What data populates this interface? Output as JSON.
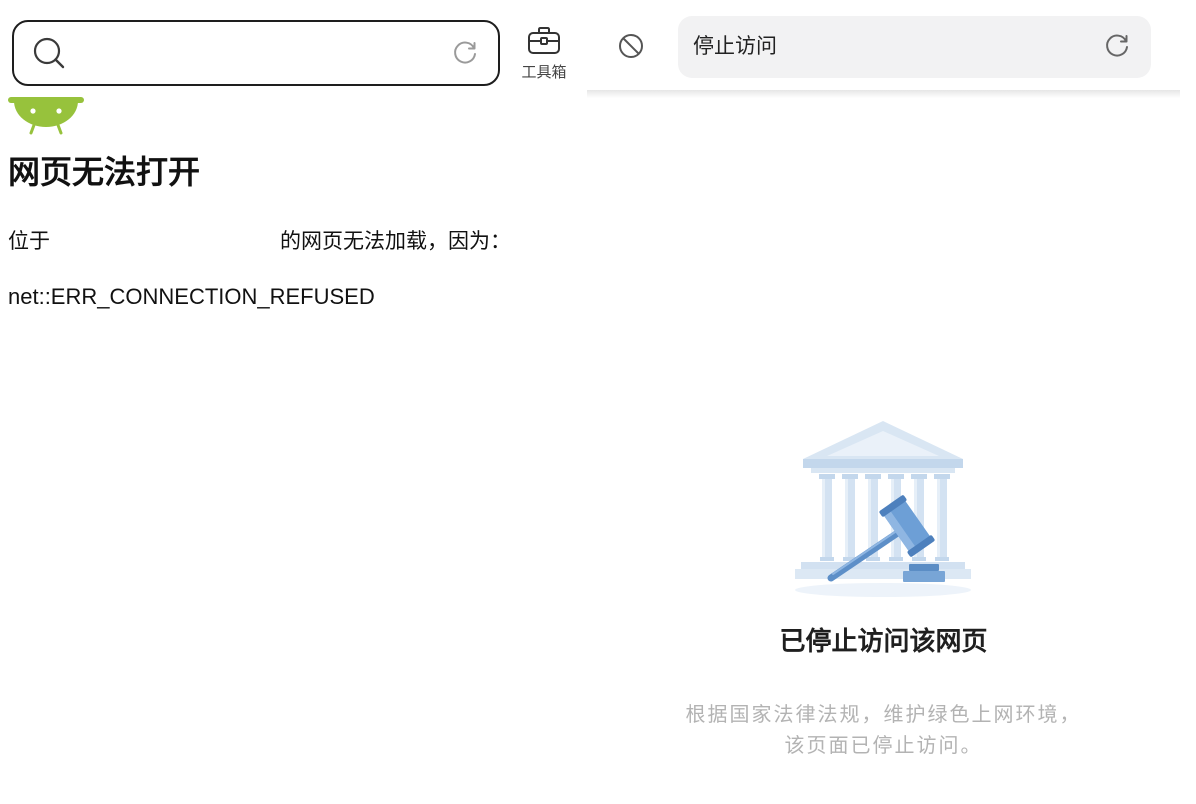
{
  "left": {
    "search_bar": {
      "icons": {
        "search": "search-icon",
        "reload": "reload-icon"
      }
    },
    "toolbox": {
      "label": "工具箱",
      "icon": "toolbox-icon"
    },
    "error": {
      "icon": "android-robot-icon",
      "title": "网页无法打开",
      "message_prefix": "位于",
      "message_suffix": "的网页无法加载，因为：",
      "code": "net::ERR_CONNECTION_REFUSED"
    }
  },
  "right": {
    "toolbar": {
      "left_icon": "block-icon",
      "reload_icon": "reload-icon"
    },
    "address": {
      "text": "停止访问"
    },
    "notice": {
      "illustration": "courthouse-gavel-illustration",
      "title": "已停止访问该网页",
      "lines": [
        "根据国家法律法规，维护绿色上网环境，",
        "该页面已停止访问。"
      ]
    }
  },
  "colors": {
    "android_green": "#97c23c",
    "illustration_blue": "#6d9fd6",
    "address_bar_bg": "#f2f2f3",
    "muted_text": "#b3b3b3",
    "text": "#1f1f1f"
  }
}
